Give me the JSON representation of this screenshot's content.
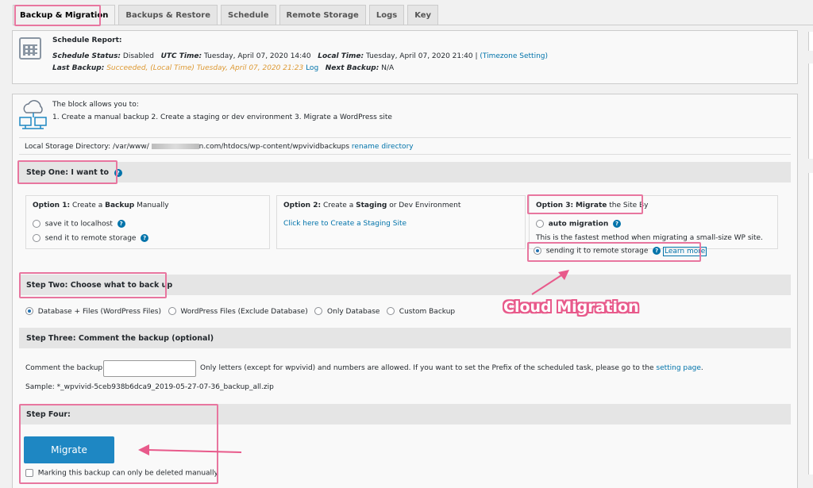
{
  "tabs": [
    "Backup & Migration",
    "Backups & Restore",
    "Schedule",
    "Remote Storage",
    "Logs",
    "Key"
  ],
  "schedule": {
    "title": "Schedule Report:",
    "status_label": "Schedule Status:",
    "status_value": "Disabled",
    "utc_label": "UTC Time:",
    "utc_value": "Tuesday, April 07, 2020 14:40",
    "local_label": "Local Time:",
    "local_value": "Tuesday, April 07, 2020 21:40 |",
    "timezone_link": "(Timezone Setting)",
    "last_label": "Last Backup:",
    "last_value": "Succeeded, (Local Time) Tuesday, April 07, 2020 21:23",
    "log_link": "Log",
    "next_label": "Next Backup:",
    "next_value": "N/A"
  },
  "block": {
    "intro": "The block allows you to:",
    "items": "1. Create a manual backup   2. Create a staging or dev environment   3. Migrate a WordPress site",
    "dir_label": "Local Storage Directory:",
    "dir_prefix": "/var/www/",
    "dir_suffix": "n.com/htdocs/wp-content/wpvividbackups",
    "rename_link": "rename directory"
  },
  "step1": {
    "title": "Step One: I want to",
    "opt1": {
      "prefix": "Option 1:",
      "mid": " Create a ",
      "bold": "Backup",
      "suffix": " Manually",
      "r1": "save it to localhost",
      "r2": "send it to remote storage"
    },
    "opt2": {
      "prefix": "Option 2:",
      "mid": " Create a ",
      "bold": "Staging",
      "suffix": " or Dev Environment",
      "link": "Click here to Create a Staging Site"
    },
    "opt3": {
      "prefix": "Option 3:",
      "mid": " ",
      "bold": "Migrate",
      "suffix": " the Site By",
      "r1": "auto migration",
      "desc": "This is the fastest method when migrating a small-size WP site.",
      "r2": "sending it to remote storage",
      "learn": "Learn more"
    }
  },
  "step2": {
    "title": "Step Two: Choose what to back up",
    "options": [
      "Database + Files (WordPress Files)",
      "WordPress Files (Exclude Database)",
      "Only Database",
      "Custom Backup"
    ]
  },
  "step3": {
    "title": "Step Three: Comment the backup (optional)",
    "comment_label": "Comment the backup:",
    "comment_value": "",
    "hint": "Only letters (except for wpvivid) and numbers are allowed. If you want to set the Prefix of the scheduled task, please go to the",
    "setting_link": "setting page",
    "hint_end": ".",
    "sample": "Sample:  *_wpvivid-5ceb938b6dca9_2019-05-27-07-36_backup_all.zip"
  },
  "step4": {
    "title": "Step Four:",
    "button": "Migrate",
    "checkbox": "Marking this backup can only be deleted manually"
  },
  "annotation": "Cloud Migration",
  "colors": {
    "accent": "#0073aa",
    "pink": "#e8769f",
    "button": "#1e87c3"
  }
}
